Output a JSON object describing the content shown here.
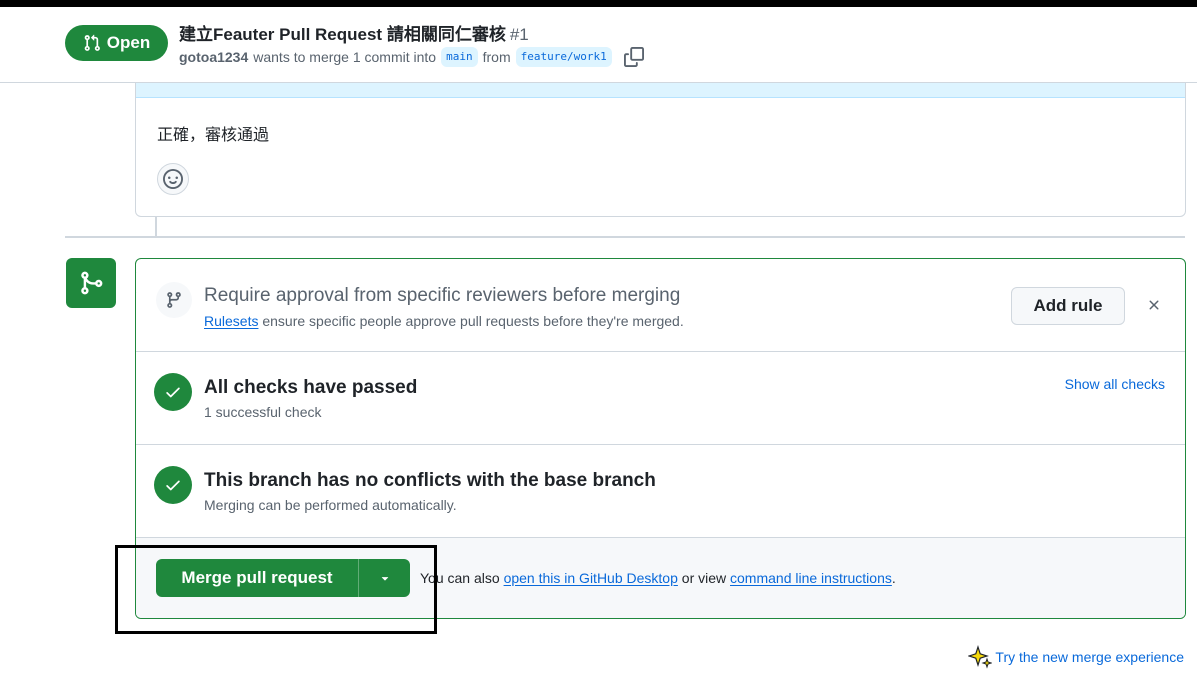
{
  "header": {
    "state": "Open",
    "title": "建立Feauter Pull Request 請相關同仁審核",
    "number": "#1",
    "author": "gotoa1234",
    "merge_text": "wants to merge 1 commit into",
    "base_branch": "main",
    "from_text": "from",
    "head_branch": "feature/work1",
    "copy_icon": "copy-icon"
  },
  "comment": {
    "body": "正確，審核通過",
    "reaction_icon": "smiley-icon"
  },
  "rules": {
    "title": "Require approval from specific reviewers before merging",
    "link": "Rulesets",
    "desc": " ensure specific people approve pull requests before they're merged.",
    "add_rule": "Add rule",
    "dismiss_icon": "x-icon"
  },
  "checks": {
    "title": "All checks have passed",
    "desc": "1 successful check",
    "show_all": "Show all checks"
  },
  "conflicts": {
    "title": "This branch has no conflicts with the base branch",
    "desc": "Merging can be performed automatically."
  },
  "merge": {
    "button": "Merge pull request",
    "alt_prefix": "You can also ",
    "desktop_link": "open this in GitHub Desktop",
    "alt_middle": " or view ",
    "cli_link": "command line instructions",
    "alt_suffix": "."
  },
  "footer": {
    "new_merge": "Try the new merge experience"
  },
  "colors": {
    "success": "#1f883d",
    "link": "#0969da",
    "muted": "#59636e",
    "border": "#d0d7de"
  }
}
